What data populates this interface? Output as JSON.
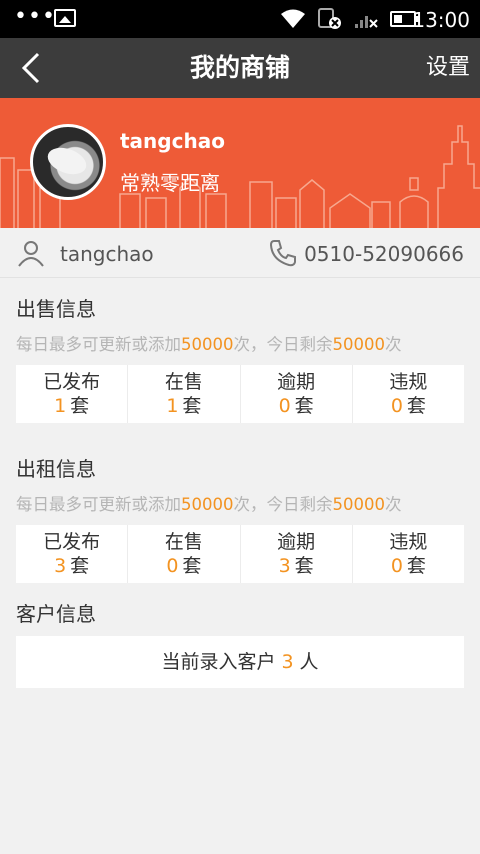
{
  "status_bar": {
    "time": "13:00",
    "dots": "•••"
  },
  "header": {
    "title": "我的商铺",
    "settings_label": "设置"
  },
  "shop": {
    "username": "tangchao",
    "shop_name": "常熟零距离",
    "account": "tangchao",
    "phone": "0510-52090666"
  },
  "sale": {
    "title": "出售信息",
    "quota_prefix": "每日最多可更新或添加",
    "quota_limit": "50000",
    "quota_middle": "次，今日剩余",
    "quota_remaining": "50000",
    "quota_suffix": "次",
    "stats": [
      {
        "label": "已发布",
        "value": "1",
        "unit": "套"
      },
      {
        "label": "在售",
        "value": "1",
        "unit": "套"
      },
      {
        "label": "逾期",
        "value": "0",
        "unit": "套"
      },
      {
        "label": "违规",
        "value": "0",
        "unit": "套"
      }
    ]
  },
  "rent": {
    "title": "出租信息",
    "quota_prefix": "每日最多可更新或添加",
    "quota_limit": "50000",
    "quota_middle": "次，今日剩余",
    "quota_remaining": "50000",
    "quota_suffix": "次",
    "stats": [
      {
        "label": "已发布",
        "value": "3",
        "unit": "套"
      },
      {
        "label": "在售",
        "value": "0",
        "unit": "套"
      },
      {
        "label": "逾期",
        "value": "3",
        "unit": "套"
      },
      {
        "label": "违规",
        "value": "0",
        "unit": "套"
      }
    ]
  },
  "customers": {
    "title": "客户信息",
    "prefix": "当前录入客户",
    "count": "3",
    "suffix": "人"
  },
  "colors": {
    "accent": "#f39321",
    "banner": "#ee5b37",
    "titlebar": "#3c3c3c"
  }
}
